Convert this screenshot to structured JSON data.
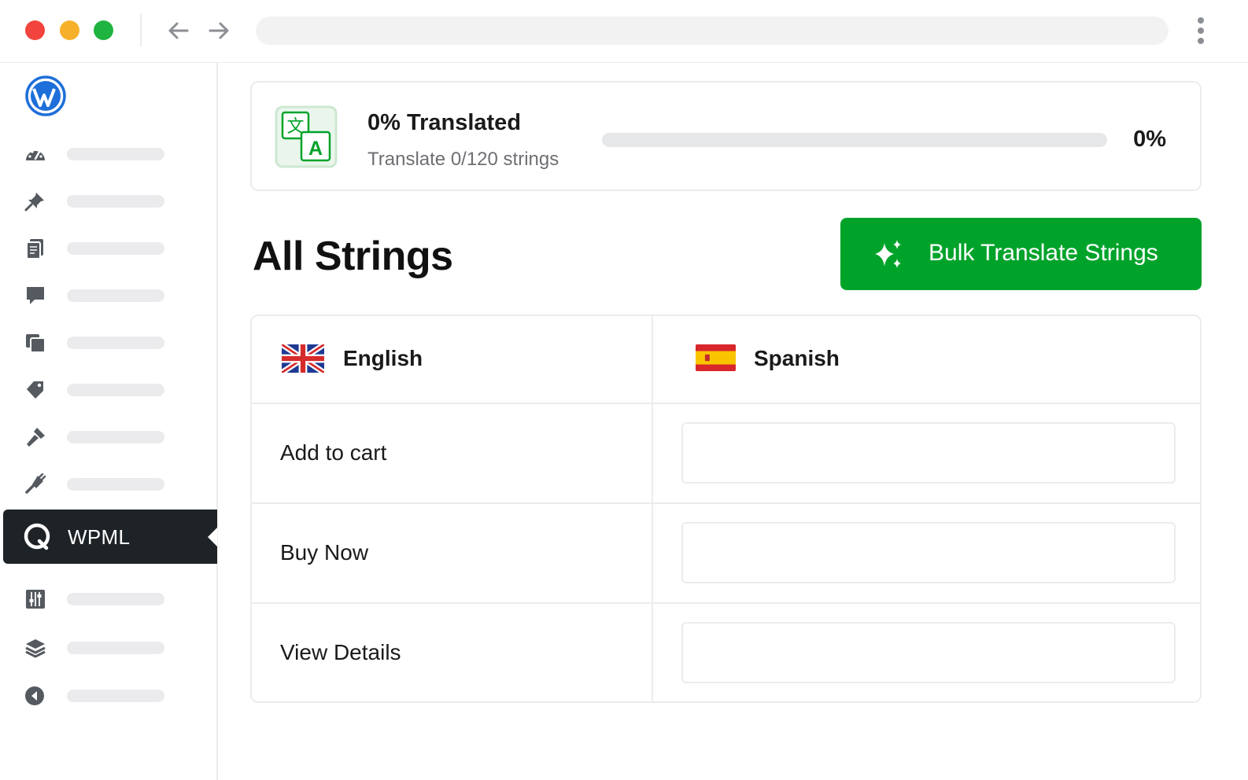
{
  "sidebar": {
    "active_item": {
      "label": "WPML"
    }
  },
  "progress": {
    "title": "0% Translated",
    "subtitle": "Translate 0/120 strings",
    "percent_label": "0%",
    "percent_value": 0,
    "accent_color": "#00a32a"
  },
  "main": {
    "page_title": "All Strings",
    "bulk_button_label": "Bulk Translate Strings"
  },
  "table": {
    "source_language": "English",
    "target_language": "Spanish",
    "rows": [
      {
        "source": "Add to cart",
        "translation": ""
      },
      {
        "source": "Buy Now",
        "translation": ""
      },
      {
        "source": "View Details",
        "translation": ""
      }
    ]
  }
}
